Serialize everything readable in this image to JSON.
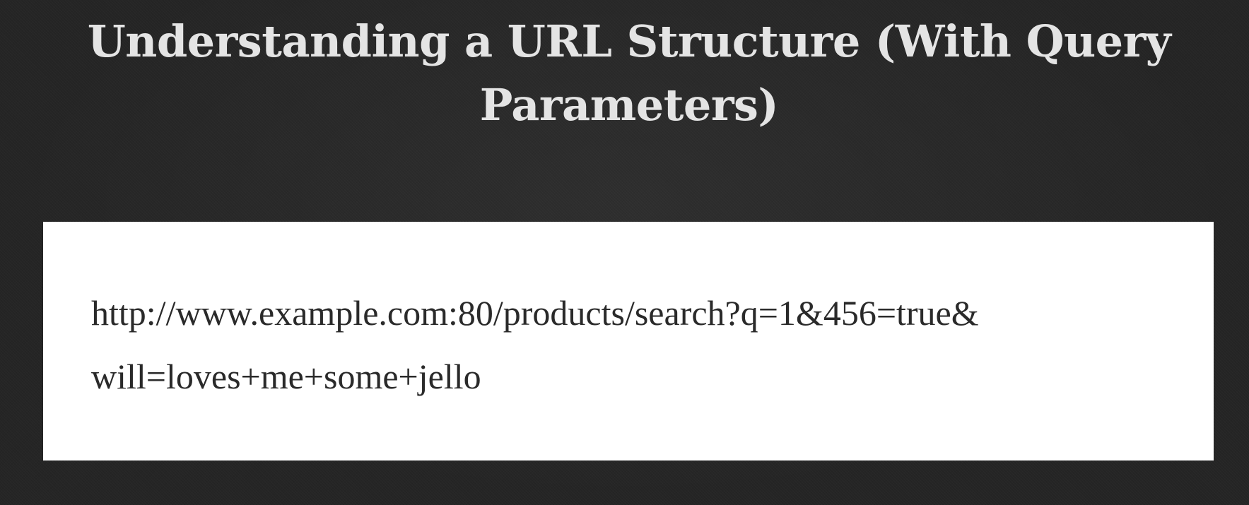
{
  "slide": {
    "title": "Understanding a URL Structure (With Query Parameters)",
    "url_line_1": "http://www.example.com:80/products/search?q=1&456=true&",
    "url_line_2": "will=loves+me+some+jello"
  },
  "colors": {
    "background": "#252525",
    "title_text": "#e4e4e4",
    "panel_background": "#ffffff",
    "url_text": "#2a2a2a"
  }
}
